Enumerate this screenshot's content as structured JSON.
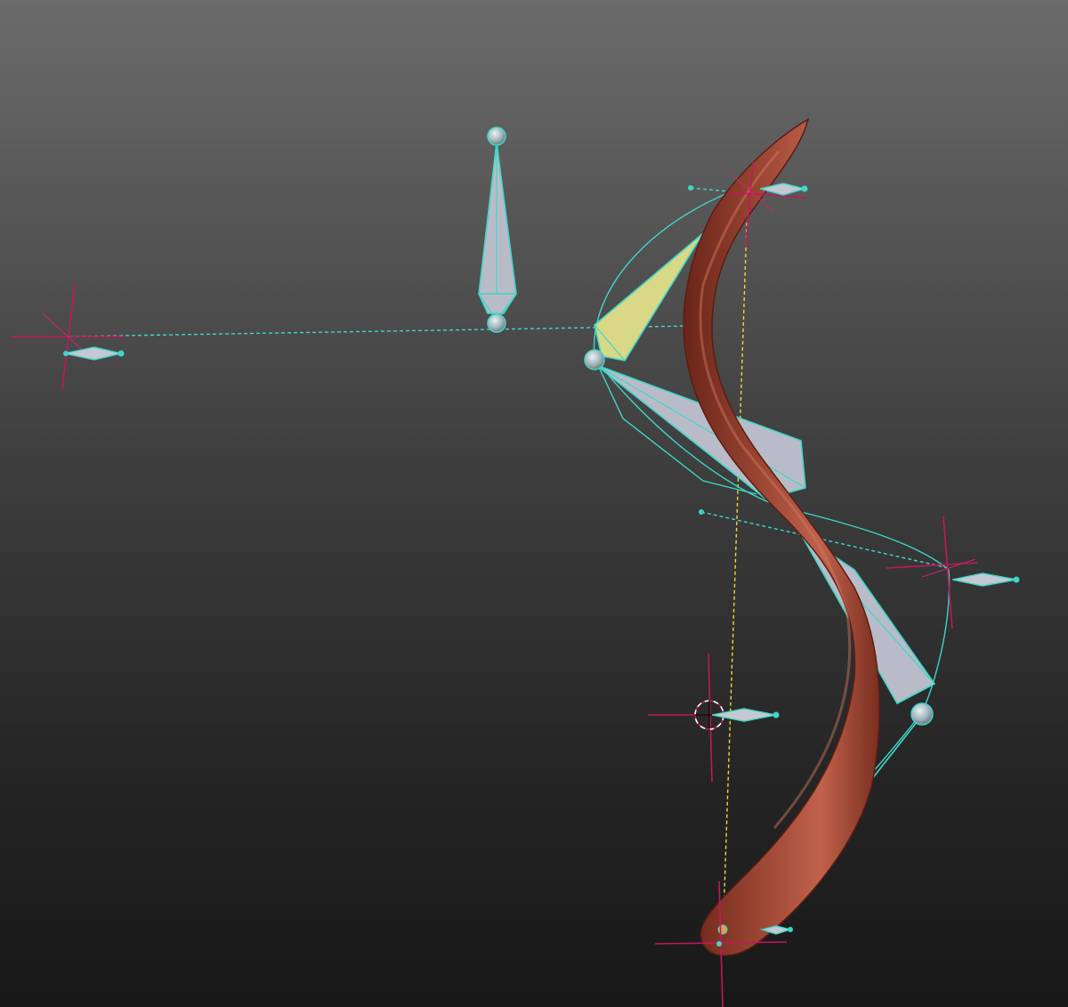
{
  "viewport": {
    "background_top": "#6b6b6b",
    "background_bottom": "#181818"
  },
  "colors": {
    "bone": "#b9bcc8",
    "bone_outline": "#3fd6c8",
    "selected_bone": "#d8d886",
    "mesh": "#8e3b2c",
    "mesh_highlight": "#c9705a",
    "target_cross": "#c2185b",
    "ik_line": "#3fd6c8",
    "pole_line": "#e5de36"
  },
  "icons": {
    "cursor": "3d-cursor-icon",
    "ik_target": "crosshair-target-icon",
    "empty": "pole-marker-icon"
  }
}
